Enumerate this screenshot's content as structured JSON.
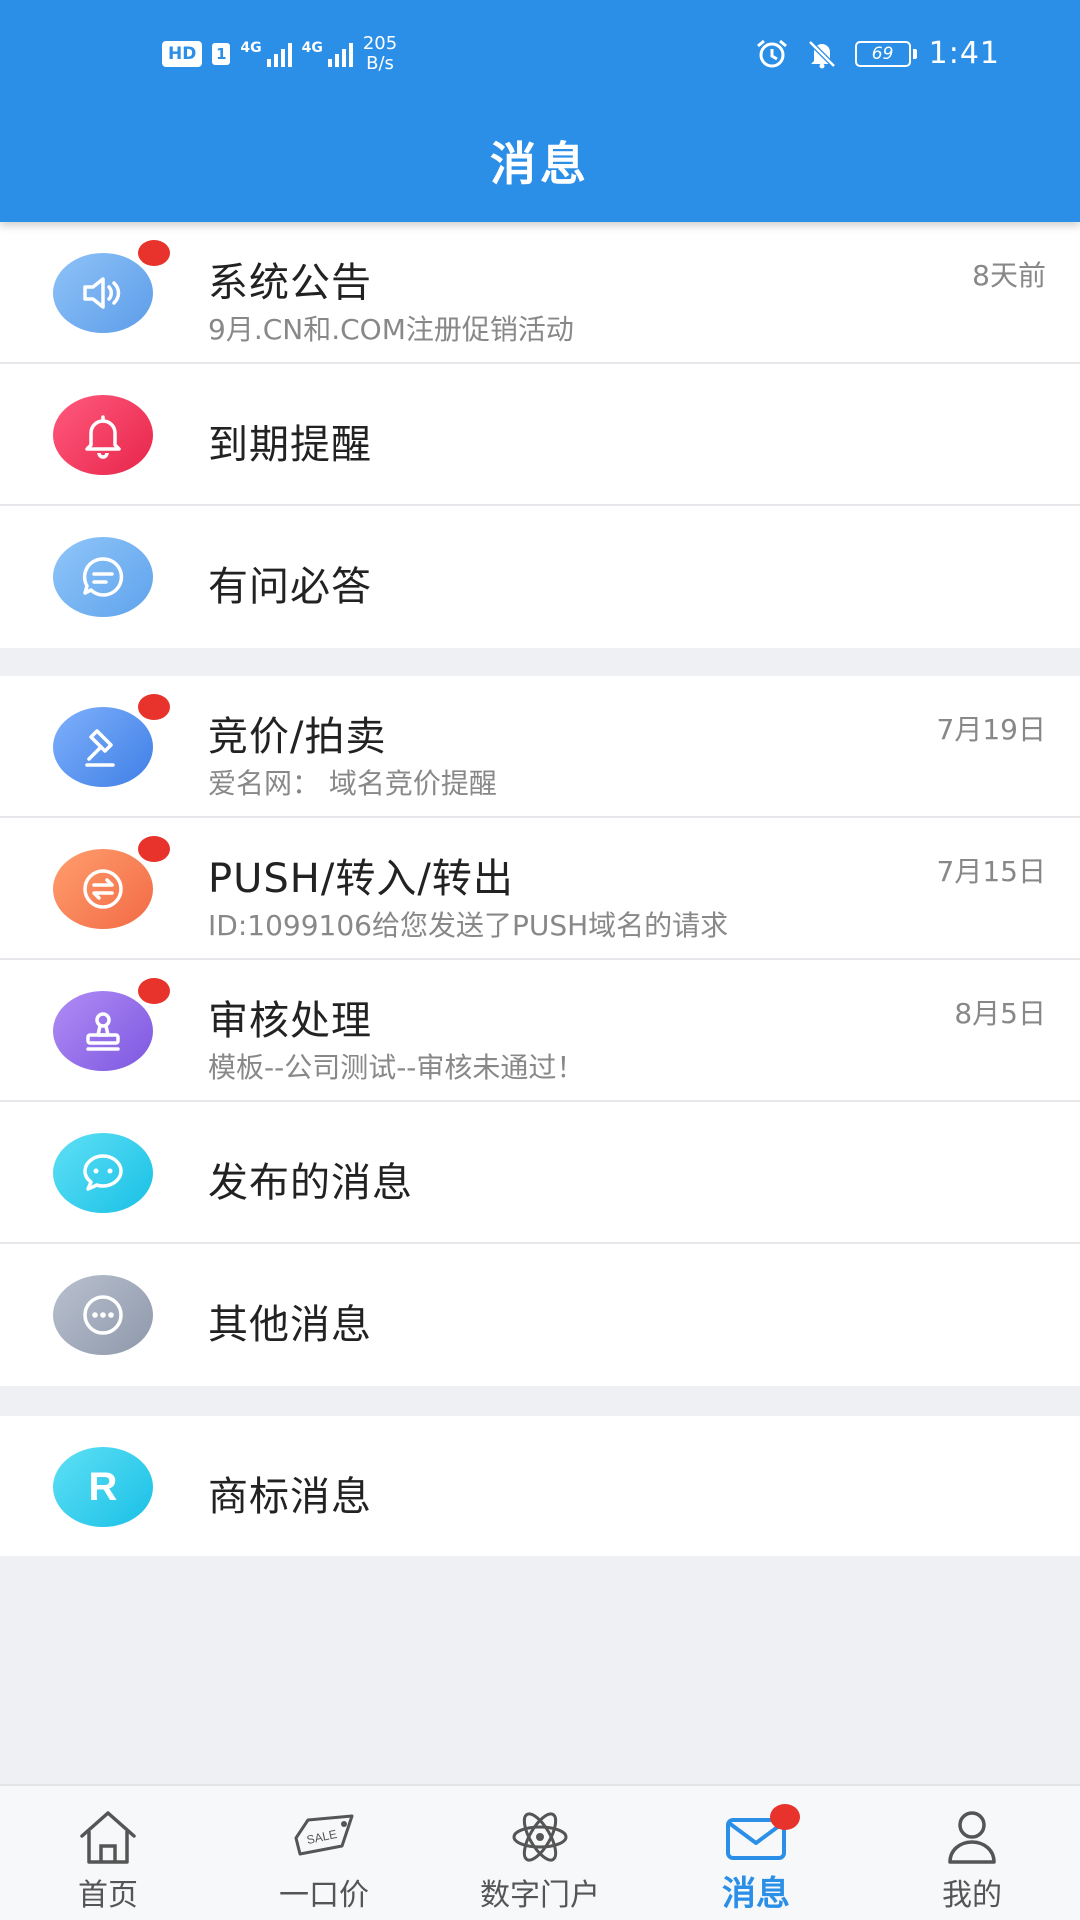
{
  "status_bar": {
    "hd_label": "HD",
    "sim_label": "1",
    "net1": "4G",
    "net2": "4G",
    "speed_value": "205",
    "speed_unit": "B/s",
    "battery": "69",
    "time": "1:41"
  },
  "header": {
    "title": "消息"
  },
  "sections": [
    {
      "items": [
        {
          "key": "announcement",
          "title": "系统公告",
          "subtitle": "9月.CN和.COM注册促销活动",
          "time": "8天前",
          "unread": true,
          "icon": "speaker-icon",
          "color_start": "#8fc3f8",
          "color_end": "#5c9ce8"
        },
        {
          "key": "expiry",
          "title": "到期提醒",
          "subtitle": "",
          "time": "",
          "unread": false,
          "icon": "bell-icon",
          "color_start": "#ff5a7e",
          "color_end": "#e8254a"
        },
        {
          "key": "qa",
          "title": "有问必答",
          "subtitle": "",
          "time": "",
          "unread": false,
          "icon": "chat-bubble-icon",
          "color_start": "#90c6f9",
          "color_end": "#5fa2ec"
        }
      ]
    },
    {
      "items": [
        {
          "key": "auction",
          "title": "竞价/拍卖",
          "subtitle": "爱名网：  域名竞价提醒",
          "time": "7月19日",
          "unread": true,
          "icon": "gavel-icon",
          "color_start": "#7fb0fb",
          "color_end": "#3f7fe6"
        },
        {
          "key": "push",
          "title": "PUSH/转入/转出",
          "subtitle": "ID:1099106给您发送了PUSH域名的请求",
          "time": "7月15日",
          "unread": true,
          "icon": "transfer-icon",
          "color_start": "#ff9e6e",
          "color_end": "#f26a45"
        },
        {
          "key": "review",
          "title": "审核处理",
          "subtitle": "模板--公司测试--审核未通过！",
          "time": "8月5日",
          "unread": true,
          "icon": "stamp-icon",
          "color_start": "#b08df5",
          "color_end": "#7d57e0"
        },
        {
          "key": "published",
          "title": "发布的消息",
          "subtitle": "",
          "time": "",
          "unread": false,
          "icon": "message-icon",
          "color_start": "#5fe0f5",
          "color_end": "#19c0e6"
        },
        {
          "key": "other",
          "title": "其他消息",
          "subtitle": "",
          "time": "",
          "unread": false,
          "icon": "more-icon",
          "color_start": "#b9c1cf",
          "color_end": "#8e98aa"
        }
      ]
    },
    {
      "items": [
        {
          "key": "trademark",
          "title": "商标消息",
          "subtitle": "",
          "time": "",
          "unread": false,
          "icon": "registered-icon",
          "color_start": "#5fe0f5",
          "color_end": "#19c0e6"
        }
      ]
    }
  ],
  "tabs": [
    {
      "label": "首页",
      "icon": "home-icon",
      "active": false
    },
    {
      "label": "一口价",
      "icon": "sale-tag-icon",
      "active": false
    },
    {
      "label": "数字门户",
      "icon": "atom-icon",
      "active": false
    },
    {
      "label": "消息",
      "icon": "mail-icon",
      "active": true,
      "badge": true
    },
    {
      "label": "我的",
      "icon": "user-icon",
      "active": false
    }
  ],
  "colors": {
    "brand": "#2b8fe8",
    "badge": "#e8332d",
    "background": "#eef0f3"
  }
}
